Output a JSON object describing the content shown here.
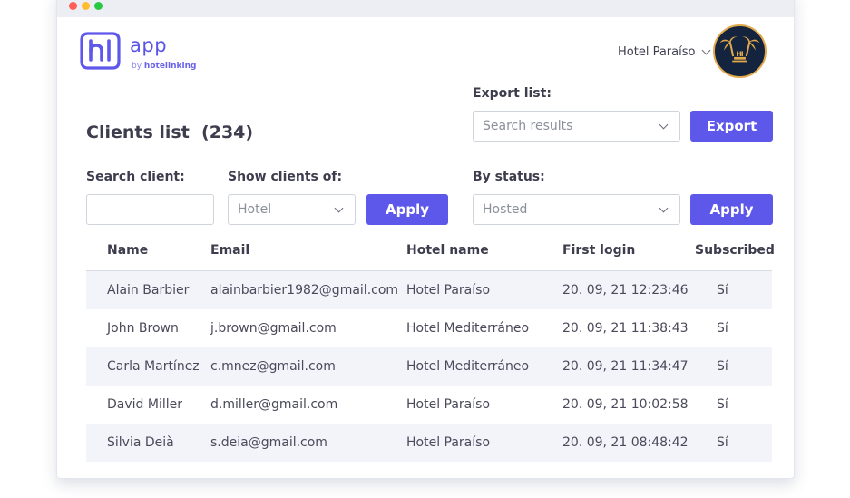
{
  "window": {
    "dots": [
      "red",
      "yellow",
      "green"
    ]
  },
  "brand": {
    "logo_icon": "hl-logo-icon",
    "app": "app",
    "by": "by",
    "company": "hotelinking"
  },
  "header": {
    "hotel_selected": "Hotel Paraíso",
    "avatar_icon": "palm-trees-avatar-icon"
  },
  "page": {
    "title": "Clients list",
    "count": "(234)"
  },
  "export": {
    "label": "Export list:",
    "select_value": "Search results",
    "button": "Export"
  },
  "search": {
    "label": "Search client:",
    "value": ""
  },
  "show_clients": {
    "label": "Show clients of:",
    "select_value": "Hotel",
    "button": "Apply"
  },
  "status": {
    "label": "By status:",
    "select_value": "Hosted",
    "button": "Apply"
  },
  "table": {
    "headers": [
      "Name",
      "Email",
      "Hotel name",
      "First login",
      "Subscribed"
    ],
    "rows": [
      [
        "Alain Barbier",
        "alainbarbier1982@gmail.com",
        "Hotel Paraíso",
        "20. 09, 21 12:23:46",
        "Sí"
      ],
      [
        "John Brown",
        "j.brown@gmail.com",
        "Hotel Mediterráneo",
        "20. 09, 21 11:38:43",
        "Sí"
      ],
      [
        "Carla Martínez",
        "c.mnez@gmail.com",
        "Hotel Mediterráneo",
        "20. 09, 21 11:34:47",
        "Sí"
      ],
      [
        "David Miller",
        "d.miller@gmail.com",
        "Hotel Paraíso",
        "20. 09, 21 10:02:58",
        "Sí"
      ],
      [
        "Silvia Deià",
        "s.deia@gmail.com",
        "Hotel Paraíso",
        "20. 09, 21 08:48:42",
        "Sí"
      ]
    ]
  },
  "colors": {
    "accent": "#5e58ea",
    "row_alt": "#f3f4fa",
    "avatar_bg": "#15243e",
    "avatar_ring": "#e0a94b"
  }
}
